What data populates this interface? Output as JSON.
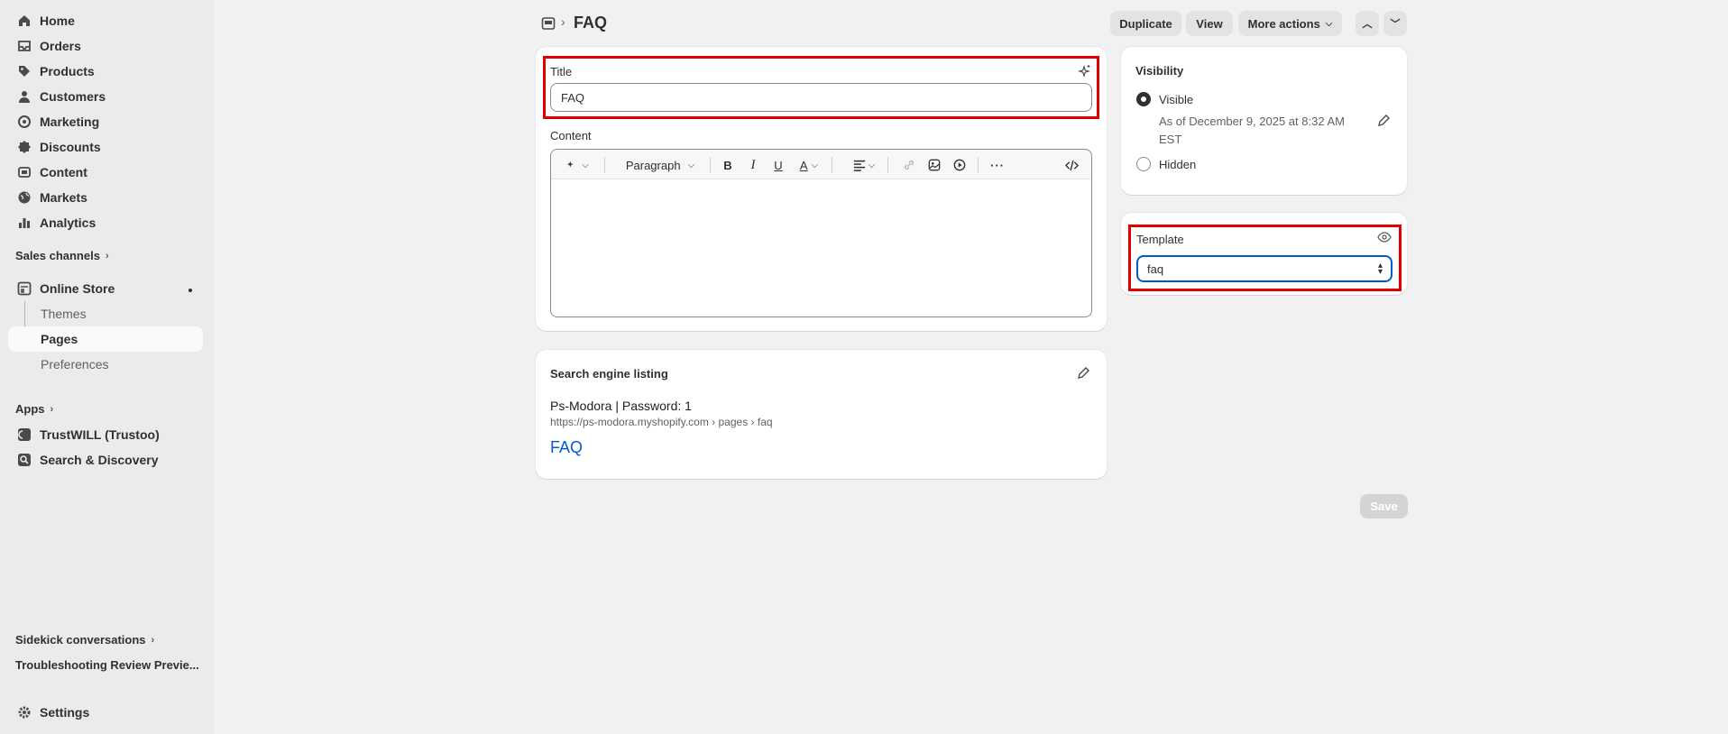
{
  "sidebar": {
    "items": [
      {
        "label": "Home",
        "icon": "home-icon"
      },
      {
        "label": "Orders",
        "icon": "inbox-icon"
      },
      {
        "label": "Products",
        "icon": "tag-icon"
      },
      {
        "label": "Customers",
        "icon": "person-icon"
      },
      {
        "label": "Marketing",
        "icon": "target-icon"
      },
      {
        "label": "Discounts",
        "icon": "discount-icon"
      },
      {
        "label": "Content",
        "icon": "content-icon"
      },
      {
        "label": "Markets",
        "icon": "globe-icon"
      },
      {
        "label": "Analytics",
        "icon": "bar-chart-icon"
      }
    ],
    "sales_channels_label": "Sales channels",
    "online_store": {
      "label": "Online Store",
      "sub": [
        "Themes",
        "Pages",
        "Preferences"
      ]
    },
    "apps_label": "Apps",
    "apps": [
      "TrustWILL (Trustoo)",
      "Search & Discovery"
    ],
    "sidekick_label": "Sidekick conversations",
    "sidekick_item": "Troubleshooting Review Previe...",
    "settings_label": "Settings"
  },
  "header": {
    "title": "FAQ",
    "duplicate_label": "Duplicate",
    "view_label": "View",
    "more_actions_label": "More actions"
  },
  "page_form": {
    "title_label": "Title",
    "title_value": "FAQ",
    "content_label": "Content",
    "paragraph_label": "Paragraph"
  },
  "seo": {
    "heading": "Search engine listing",
    "store_title": "Ps-Modora | Password: 1",
    "url": "https://ps-modora.myshopify.com › pages › faq",
    "page_title": "FAQ"
  },
  "visibility": {
    "heading": "Visibility",
    "visible_label": "Visible",
    "visible_date": "As of December 9, 2025 at 8:32 AM",
    "visible_tz": "EST",
    "hidden_label": "Hidden",
    "selected": "Visible"
  },
  "template": {
    "heading": "Template",
    "selected_value": "faq"
  },
  "save_label": "Save",
  "colors": {
    "highlight": "#e00000",
    "focus": "#005bd3",
    "link": "#005bd3"
  }
}
